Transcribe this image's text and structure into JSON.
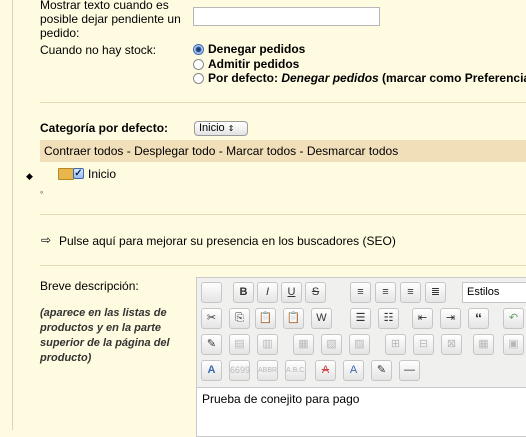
{
  "pending_text": {
    "label_lines": [
      "Mostrar texto cuando es",
      "posible dejar pendiente un",
      "pedido:"
    ],
    "value": ""
  },
  "stock": {
    "label": "Cuando no hay stock:",
    "options": [
      {
        "label": "Denegar pedidos",
        "selected": true
      },
      {
        "label": "Admitir pedidos",
        "selected": false
      },
      {
        "label_prefix": "Por defecto: ",
        "label_default": "Denegar pedidos",
        "label_suffix": " (marcar como Preferencia",
        "selected": false
      }
    ]
  },
  "category": {
    "label": "Categoría por defecto:",
    "selected": "Inicio",
    "actions": {
      "collapse": "Contraer todos",
      "expand": "Desplegar todo",
      "mark": "Marcar todos",
      "unmark": "Desmarcar todos",
      "separator": " - "
    },
    "tree_root": "Inicio"
  },
  "seo": {
    "link": "Pulse aquí para mejorar su presencia en los buscadores (SEO)"
  },
  "short_description": {
    "label": "Breve descripción:",
    "note_lines": [
      "(aparece en las listas de",
      "productos y en la parte",
      "superior de la página del",
      "producto)"
    ],
    "styles_label": "Estilos",
    "content": "Prueba de conejito para pago"
  },
  "toolbar_icons": {
    "row1": [
      "new-document-icon",
      "bold-icon",
      "italic-icon",
      "underline-icon",
      "strikethrough-icon",
      "align-left-icon",
      "align-center-icon",
      "align-right-icon",
      "align-justify-icon"
    ],
    "row2": [
      "cut-icon",
      "copy-icon",
      "paste-icon",
      "paste-text-icon",
      "paste-word-icon",
      "bullet-list-icon",
      "numbered-list-icon",
      "outdent-icon",
      "indent-icon",
      "blockquote-icon",
      "undo-icon"
    ],
    "row3": [
      "edit-icon",
      "table-row-icon",
      "table-col-icon",
      "table-insert-icon",
      "table-delete-icon",
      "cell-icon",
      "merge-icon",
      "split-icon",
      "table-props-icon",
      "table-icon",
      "table-extra-icon"
    ],
    "row4": [
      "text-style-icon",
      "quote-icon",
      "abbr-icon",
      "acronym-icon",
      "strike-icon",
      "char-icon",
      "attribs-icon",
      "rule-icon"
    ]
  },
  "labels": {
    "bold": "B",
    "italic": "I",
    "underline": "U",
    "strike": "S",
    "quote": "“",
    "q": "“",
    "abbr": "ABBR",
    "acronym": "A.B.C.",
    "a": "A",
    "a2": "A"
  }
}
